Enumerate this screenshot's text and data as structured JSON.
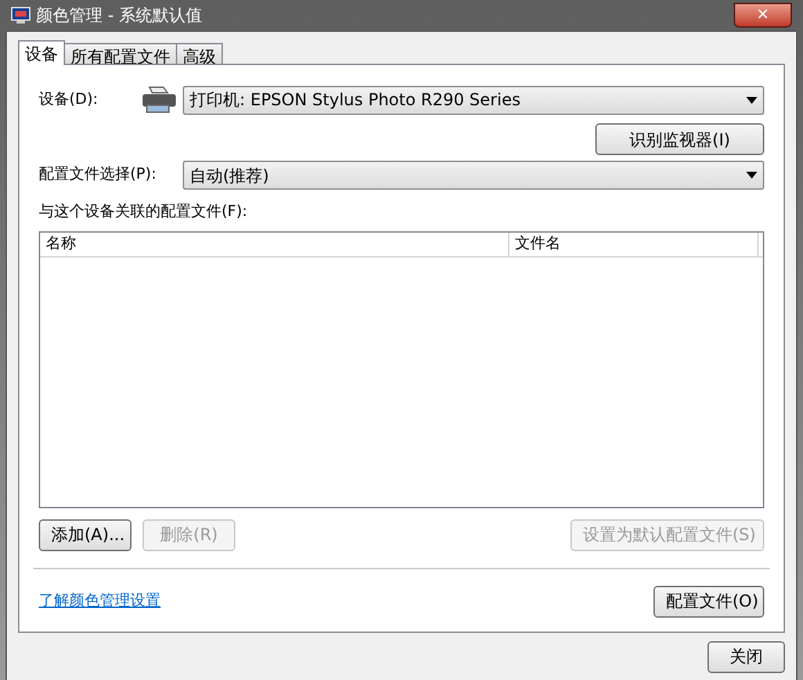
{
  "window": {
    "title": "颜色管理 - 系统默认值",
    "close_glyph": "✕"
  },
  "tabs": [
    {
      "label": "设备",
      "selected": true
    },
    {
      "label": "所有配置文件",
      "selected": false
    },
    {
      "label": "高级",
      "selected": false
    }
  ],
  "device": {
    "label": "设备(D):",
    "value": "打印机: EPSON Stylus Photo R290 Series"
  },
  "identify_button": "识别监视器(I)",
  "profile_selection": {
    "label": "配置文件选择(P):",
    "value": "自动(推荐)"
  },
  "associated_label": "与这个设备关联的配置文件(F):",
  "table": {
    "columns": [
      "名称",
      "文件名"
    ]
  },
  "buttons": [
    {
      "label": "添加(A)...",
      "disabled": false
    },
    {
      "label": "删除(R)",
      "disabled": true
    },
    {
      "label": "设置为默认配置文件(S)",
      "disabled": true
    }
  ],
  "link": "了解颜色管理设置",
  "profiles_button": "配置文件(O)",
  "close_button": "关闭"
}
